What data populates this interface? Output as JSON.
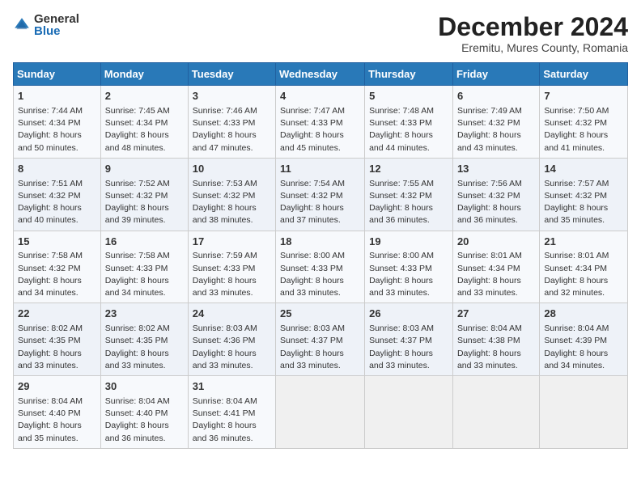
{
  "header": {
    "logo_general": "General",
    "logo_blue": "Blue",
    "month_title": "December 2024",
    "subtitle": "Eremitu, Mures County, Romania"
  },
  "weekdays": [
    "Sunday",
    "Monday",
    "Tuesday",
    "Wednesday",
    "Thursday",
    "Friday",
    "Saturday"
  ],
  "weeks": [
    [
      {
        "day": "1",
        "sunrise": "7:44 AM",
        "sunset": "4:34 PM",
        "daylight": "8 hours and 50 minutes."
      },
      {
        "day": "2",
        "sunrise": "7:45 AM",
        "sunset": "4:34 PM",
        "daylight": "8 hours and 48 minutes."
      },
      {
        "day": "3",
        "sunrise": "7:46 AM",
        "sunset": "4:33 PM",
        "daylight": "8 hours and 47 minutes."
      },
      {
        "day": "4",
        "sunrise": "7:47 AM",
        "sunset": "4:33 PM",
        "daylight": "8 hours and 45 minutes."
      },
      {
        "day": "5",
        "sunrise": "7:48 AM",
        "sunset": "4:33 PM",
        "daylight": "8 hours and 44 minutes."
      },
      {
        "day": "6",
        "sunrise": "7:49 AM",
        "sunset": "4:32 PM",
        "daylight": "8 hours and 43 minutes."
      },
      {
        "day": "7",
        "sunrise": "7:50 AM",
        "sunset": "4:32 PM",
        "daylight": "8 hours and 41 minutes."
      }
    ],
    [
      {
        "day": "8",
        "sunrise": "7:51 AM",
        "sunset": "4:32 PM",
        "daylight": "8 hours and 40 minutes."
      },
      {
        "day": "9",
        "sunrise": "7:52 AM",
        "sunset": "4:32 PM",
        "daylight": "8 hours and 39 minutes."
      },
      {
        "day": "10",
        "sunrise": "7:53 AM",
        "sunset": "4:32 PM",
        "daylight": "8 hours and 38 minutes."
      },
      {
        "day": "11",
        "sunrise": "7:54 AM",
        "sunset": "4:32 PM",
        "daylight": "8 hours and 37 minutes."
      },
      {
        "day": "12",
        "sunrise": "7:55 AM",
        "sunset": "4:32 PM",
        "daylight": "8 hours and 36 minutes."
      },
      {
        "day": "13",
        "sunrise": "7:56 AM",
        "sunset": "4:32 PM",
        "daylight": "8 hours and 36 minutes."
      },
      {
        "day": "14",
        "sunrise": "7:57 AM",
        "sunset": "4:32 PM",
        "daylight": "8 hours and 35 minutes."
      }
    ],
    [
      {
        "day": "15",
        "sunrise": "7:58 AM",
        "sunset": "4:32 PM",
        "daylight": "8 hours and 34 minutes."
      },
      {
        "day": "16",
        "sunrise": "7:58 AM",
        "sunset": "4:33 PM",
        "daylight": "8 hours and 34 minutes."
      },
      {
        "day": "17",
        "sunrise": "7:59 AM",
        "sunset": "4:33 PM",
        "daylight": "8 hours and 33 minutes."
      },
      {
        "day": "18",
        "sunrise": "8:00 AM",
        "sunset": "4:33 PM",
        "daylight": "8 hours and 33 minutes."
      },
      {
        "day": "19",
        "sunrise": "8:00 AM",
        "sunset": "4:33 PM",
        "daylight": "8 hours and 33 minutes."
      },
      {
        "day": "20",
        "sunrise": "8:01 AM",
        "sunset": "4:34 PM",
        "daylight": "8 hours and 33 minutes."
      },
      {
        "day": "21",
        "sunrise": "8:01 AM",
        "sunset": "4:34 PM",
        "daylight": "8 hours and 32 minutes."
      }
    ],
    [
      {
        "day": "22",
        "sunrise": "8:02 AM",
        "sunset": "4:35 PM",
        "daylight": "8 hours and 33 minutes."
      },
      {
        "day": "23",
        "sunrise": "8:02 AM",
        "sunset": "4:35 PM",
        "daylight": "8 hours and 33 minutes."
      },
      {
        "day": "24",
        "sunrise": "8:03 AM",
        "sunset": "4:36 PM",
        "daylight": "8 hours and 33 minutes."
      },
      {
        "day": "25",
        "sunrise": "8:03 AM",
        "sunset": "4:37 PM",
        "daylight": "8 hours and 33 minutes."
      },
      {
        "day": "26",
        "sunrise": "8:03 AM",
        "sunset": "4:37 PM",
        "daylight": "8 hours and 33 minutes."
      },
      {
        "day": "27",
        "sunrise": "8:04 AM",
        "sunset": "4:38 PM",
        "daylight": "8 hours and 33 minutes."
      },
      {
        "day": "28",
        "sunrise": "8:04 AM",
        "sunset": "4:39 PM",
        "daylight": "8 hours and 34 minutes."
      }
    ],
    [
      {
        "day": "29",
        "sunrise": "8:04 AM",
        "sunset": "4:40 PM",
        "daylight": "8 hours and 35 minutes."
      },
      {
        "day": "30",
        "sunrise": "8:04 AM",
        "sunset": "4:40 PM",
        "daylight": "8 hours and 36 minutes."
      },
      {
        "day": "31",
        "sunrise": "8:04 AM",
        "sunset": "4:41 PM",
        "daylight": "8 hours and 36 minutes."
      },
      null,
      null,
      null,
      null
    ]
  ]
}
